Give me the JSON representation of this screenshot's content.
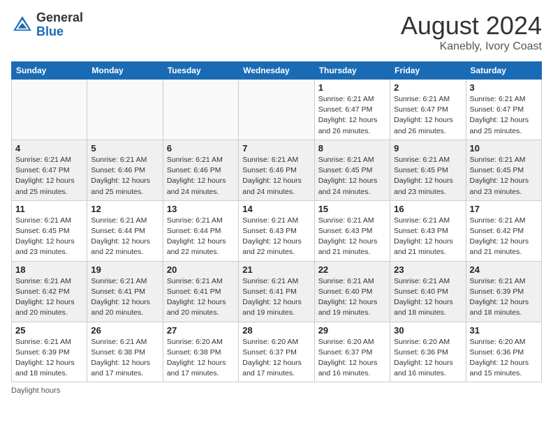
{
  "header": {
    "logo_general": "General",
    "logo_blue": "Blue",
    "month_year": "August 2024",
    "location": "Kanebly, Ivory Coast"
  },
  "footer": {
    "note": "Daylight hours"
  },
  "weekdays": [
    "Sunday",
    "Monday",
    "Tuesday",
    "Wednesday",
    "Thursday",
    "Friday",
    "Saturday"
  ],
  "weeks": [
    [
      {
        "day": "",
        "info": ""
      },
      {
        "day": "",
        "info": ""
      },
      {
        "day": "",
        "info": ""
      },
      {
        "day": "",
        "info": ""
      },
      {
        "day": "1",
        "info": "Sunrise: 6:21 AM\nSunset: 6:47 PM\nDaylight: 12 hours\nand 26 minutes."
      },
      {
        "day": "2",
        "info": "Sunrise: 6:21 AM\nSunset: 6:47 PM\nDaylight: 12 hours\nand 26 minutes."
      },
      {
        "day": "3",
        "info": "Sunrise: 6:21 AM\nSunset: 6:47 PM\nDaylight: 12 hours\nand 25 minutes."
      }
    ],
    [
      {
        "day": "4",
        "info": "Sunrise: 6:21 AM\nSunset: 6:47 PM\nDaylight: 12 hours\nand 25 minutes."
      },
      {
        "day": "5",
        "info": "Sunrise: 6:21 AM\nSunset: 6:46 PM\nDaylight: 12 hours\nand 25 minutes."
      },
      {
        "day": "6",
        "info": "Sunrise: 6:21 AM\nSunset: 6:46 PM\nDaylight: 12 hours\nand 24 minutes."
      },
      {
        "day": "7",
        "info": "Sunrise: 6:21 AM\nSunset: 6:46 PM\nDaylight: 12 hours\nand 24 minutes."
      },
      {
        "day": "8",
        "info": "Sunrise: 6:21 AM\nSunset: 6:45 PM\nDaylight: 12 hours\nand 24 minutes."
      },
      {
        "day": "9",
        "info": "Sunrise: 6:21 AM\nSunset: 6:45 PM\nDaylight: 12 hours\nand 23 minutes."
      },
      {
        "day": "10",
        "info": "Sunrise: 6:21 AM\nSunset: 6:45 PM\nDaylight: 12 hours\nand 23 minutes."
      }
    ],
    [
      {
        "day": "11",
        "info": "Sunrise: 6:21 AM\nSunset: 6:45 PM\nDaylight: 12 hours\nand 23 minutes."
      },
      {
        "day": "12",
        "info": "Sunrise: 6:21 AM\nSunset: 6:44 PM\nDaylight: 12 hours\nand 22 minutes."
      },
      {
        "day": "13",
        "info": "Sunrise: 6:21 AM\nSunset: 6:44 PM\nDaylight: 12 hours\nand 22 minutes."
      },
      {
        "day": "14",
        "info": "Sunrise: 6:21 AM\nSunset: 6:43 PM\nDaylight: 12 hours\nand 22 minutes."
      },
      {
        "day": "15",
        "info": "Sunrise: 6:21 AM\nSunset: 6:43 PM\nDaylight: 12 hours\nand 21 minutes."
      },
      {
        "day": "16",
        "info": "Sunrise: 6:21 AM\nSunset: 6:43 PM\nDaylight: 12 hours\nand 21 minutes."
      },
      {
        "day": "17",
        "info": "Sunrise: 6:21 AM\nSunset: 6:42 PM\nDaylight: 12 hours\nand 21 minutes."
      }
    ],
    [
      {
        "day": "18",
        "info": "Sunrise: 6:21 AM\nSunset: 6:42 PM\nDaylight: 12 hours\nand 20 minutes."
      },
      {
        "day": "19",
        "info": "Sunrise: 6:21 AM\nSunset: 6:41 PM\nDaylight: 12 hours\nand 20 minutes."
      },
      {
        "day": "20",
        "info": "Sunrise: 6:21 AM\nSunset: 6:41 PM\nDaylight: 12 hours\nand 20 minutes."
      },
      {
        "day": "21",
        "info": "Sunrise: 6:21 AM\nSunset: 6:41 PM\nDaylight: 12 hours\nand 19 minutes."
      },
      {
        "day": "22",
        "info": "Sunrise: 6:21 AM\nSunset: 6:40 PM\nDaylight: 12 hours\nand 19 minutes."
      },
      {
        "day": "23",
        "info": "Sunrise: 6:21 AM\nSunset: 6:40 PM\nDaylight: 12 hours\nand 18 minutes."
      },
      {
        "day": "24",
        "info": "Sunrise: 6:21 AM\nSunset: 6:39 PM\nDaylight: 12 hours\nand 18 minutes."
      }
    ],
    [
      {
        "day": "25",
        "info": "Sunrise: 6:21 AM\nSunset: 6:39 PM\nDaylight: 12 hours\nand 18 minutes."
      },
      {
        "day": "26",
        "info": "Sunrise: 6:21 AM\nSunset: 6:38 PM\nDaylight: 12 hours\nand 17 minutes."
      },
      {
        "day": "27",
        "info": "Sunrise: 6:20 AM\nSunset: 6:38 PM\nDaylight: 12 hours\nand 17 minutes."
      },
      {
        "day": "28",
        "info": "Sunrise: 6:20 AM\nSunset: 6:37 PM\nDaylight: 12 hours\nand 17 minutes."
      },
      {
        "day": "29",
        "info": "Sunrise: 6:20 AM\nSunset: 6:37 PM\nDaylight: 12 hours\nand 16 minutes."
      },
      {
        "day": "30",
        "info": "Sunrise: 6:20 AM\nSunset: 6:36 PM\nDaylight: 12 hours\nand 16 minutes."
      },
      {
        "day": "31",
        "info": "Sunrise: 6:20 AM\nSunset: 6:36 PM\nDaylight: 12 hours\nand 15 minutes."
      }
    ]
  ]
}
